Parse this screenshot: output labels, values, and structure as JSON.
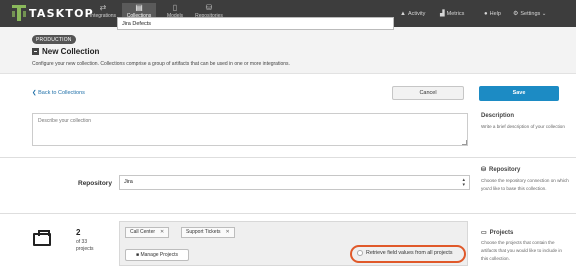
{
  "nav": {
    "logo_text": "TASKTOP",
    "logo_color": "#8ab85b",
    "items": [
      {
        "label": "Integrations",
        "icon": "integrations-icon",
        "glyph": "⇄"
      },
      {
        "label": "Collections",
        "icon": "collections-icon",
        "glyph": "▤"
      },
      {
        "label": "Models",
        "icon": "models-icon",
        "glyph": "▯"
      },
      {
        "label": "Repositories",
        "icon": "repositories-icon",
        "glyph": "⛁"
      }
    ],
    "right": [
      {
        "label": "Activity",
        "icon": "bell-icon",
        "glyph": "🔔"
      },
      {
        "label": "Metrics",
        "icon": "metrics-icon",
        "glyph": "▟"
      },
      {
        "label": "Help",
        "icon": "help-icon",
        "glyph": "●"
      },
      {
        "label": "Settings ⌄",
        "icon": "gear-icon",
        "glyph": "⚙"
      }
    ]
  },
  "header": {
    "badge": "PRODUCTION",
    "title": "New Collection",
    "name_value": "Jira Defects",
    "subtitle": "Configure your new collection. Collections comprise a group of artifacts that can be used in one or more integrations."
  },
  "actions": {
    "back": "❮ Back to Collections",
    "cancel": "Cancel",
    "save": "Save",
    "accent": "#1c8bc4"
  },
  "description": {
    "placeholder": "Describe your collection",
    "side_title": "Description",
    "side_text": "Write a brief description of your collection"
  },
  "repository": {
    "label": "Repository",
    "selected": "Jira",
    "side_title": "Repository",
    "side_text": "Choose the repository connection on which you'd like to base this collection."
  },
  "projects": {
    "count": "2",
    "of_text": "of 33",
    "unit": "projects",
    "tags": [
      "Call Center",
      "Support Tickets"
    ],
    "manage": "Manage Projects",
    "retrieve": "Retrieve field values from all projects",
    "side_title": "Projects",
    "side_text": "Choose the projects that contain the artifacts that you would like to include in this collection.",
    "highlight_color": "#e0592a"
  }
}
